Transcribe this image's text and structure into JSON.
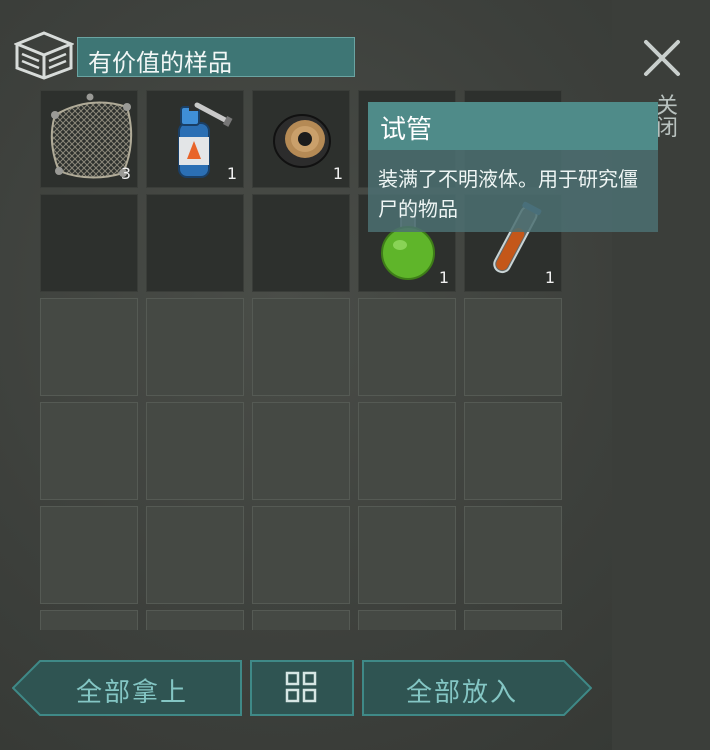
{
  "header": {
    "title": "有价值的样品",
    "side_label": "关闭"
  },
  "inventory": {
    "slots": [
      {
        "item": "net",
        "count": "3"
      },
      {
        "item": "gas-torch",
        "count": "1"
      },
      {
        "item": "speaker",
        "count": "1"
      },
      {
        "item": "hidden",
        "count": ""
      },
      {
        "item": "hidden",
        "count": ""
      },
      {
        "item": "",
        "count": ""
      },
      {
        "item": "",
        "count": ""
      },
      {
        "item": "",
        "count": ""
      },
      {
        "item": "green-flask",
        "count": "1"
      },
      {
        "item": "test-tube",
        "count": "1"
      }
    ]
  },
  "tooltip": {
    "title": "试管",
    "description": "装满了不明液体。用于研究僵尸的物品"
  },
  "buttons": {
    "take_all": "全部拿上",
    "put_all": "全部放入"
  },
  "colors": {
    "accent": "#3e7675",
    "button_text": "#84c6c4",
    "button_fill": "#2f5452"
  }
}
